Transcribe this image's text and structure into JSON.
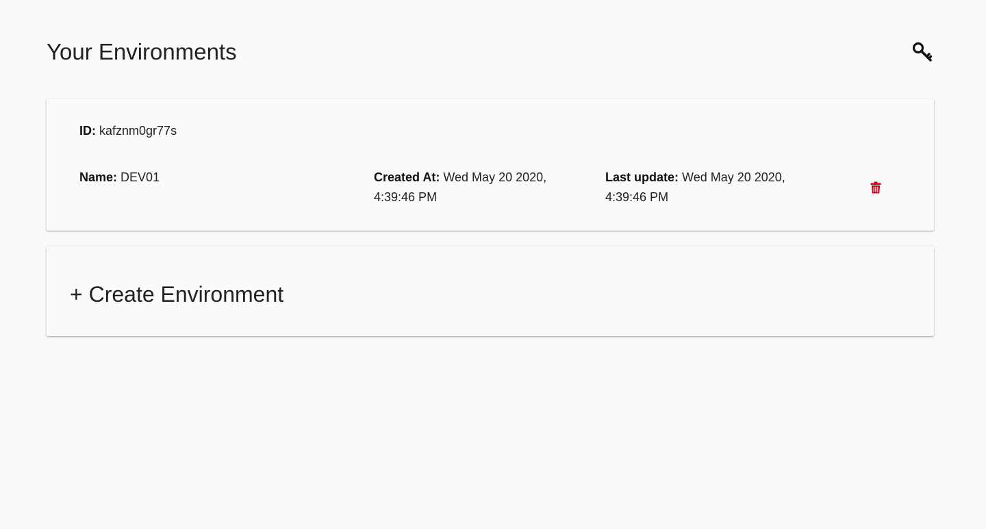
{
  "header": {
    "title": "Your Environments",
    "key_icon": "key-icon"
  },
  "environment": {
    "id_label": "ID:",
    "id_value": "kafznm0gr77s",
    "name_label": "Name:",
    "name_value": "DEV01",
    "created_label": "Created At:",
    "created_value": "Wed May 20 2020, 4:39:46 PM",
    "updated_label": "Last update:",
    "updated_value": "Wed May 20 2020, 4:39:46 PM",
    "delete_icon": "trash-icon",
    "delete_color": "#d0021b"
  },
  "create": {
    "label": "+ Create Environment"
  }
}
